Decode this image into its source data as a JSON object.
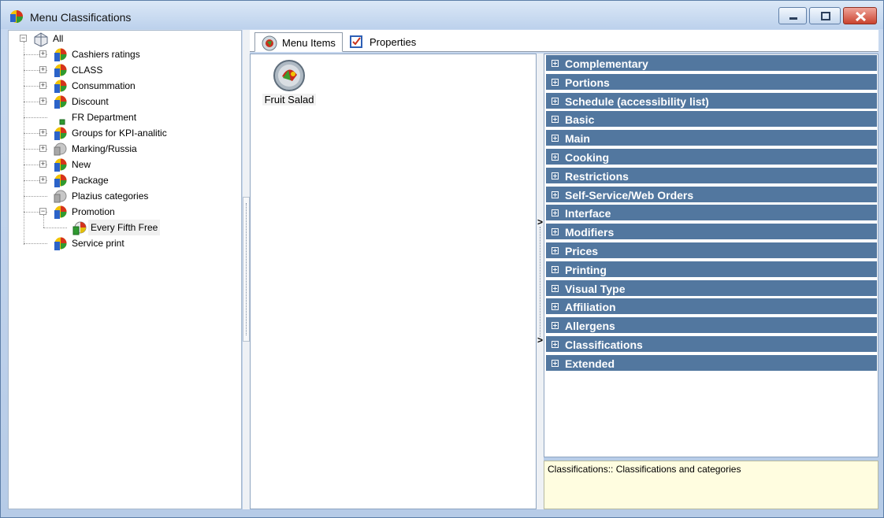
{
  "window": {
    "title": "Menu Classifications"
  },
  "tree": {
    "root": "All",
    "items": [
      {
        "label": "Cashiers ratings",
        "expandable": true,
        "icon": "classification-icon"
      },
      {
        "label": "CLASS",
        "expandable": true,
        "icon": "classification-icon"
      },
      {
        "label": "Consummation",
        "expandable": true,
        "icon": "classification-icon"
      },
      {
        "label": "Discount",
        "expandable": true,
        "icon": "classification-icon"
      },
      {
        "label": "FR Department",
        "expandable": false,
        "icon": "small-square-icon"
      },
      {
        "label": "Groups for KPI-analitic",
        "expandable": true,
        "icon": "classification-icon"
      },
      {
        "label": "Marking/Russia",
        "expandable": true,
        "icon": "gray-classification-icon"
      },
      {
        "label": "New",
        "expandable": true,
        "icon": "classification-icon"
      },
      {
        "label": "Package",
        "expandable": true,
        "icon": "classification-icon"
      },
      {
        "label": "Plazius categories",
        "expandable": false,
        "icon": "gray-classification-icon"
      },
      {
        "label": "Promotion",
        "expandable": true,
        "expanded": true,
        "icon": "classification-icon"
      },
      {
        "label": "Every Fifth Free",
        "child": true,
        "selected": true,
        "icon": "category-icon"
      },
      {
        "label": "Service print",
        "expandable": false,
        "icon": "classification-icon"
      }
    ]
  },
  "tabs": [
    {
      "label": "Menu Items",
      "icon": "menu-items-icon",
      "active": true
    },
    {
      "label": "Properties",
      "icon": "properties-icon",
      "active": false
    }
  ],
  "menu_items": [
    {
      "label": "Fruit Salad",
      "icon": "fruit-salad-icon"
    }
  ],
  "property_categories": [
    "Complementary",
    "Portions",
    "Schedule (accessibility list)",
    "Basic",
    "Main",
    "Cooking",
    "Restrictions",
    "Self-Service/Web Orders",
    "Interface",
    "Modifiers",
    "Prices",
    "Printing",
    "Visual Type",
    "Affiliation",
    "Allergens",
    "Classifications",
    "Extended"
  ],
  "description": "Classifications:: Classifications and categories",
  "colors": {
    "category_header": "#52779f",
    "description_bg": "#fffde0"
  }
}
